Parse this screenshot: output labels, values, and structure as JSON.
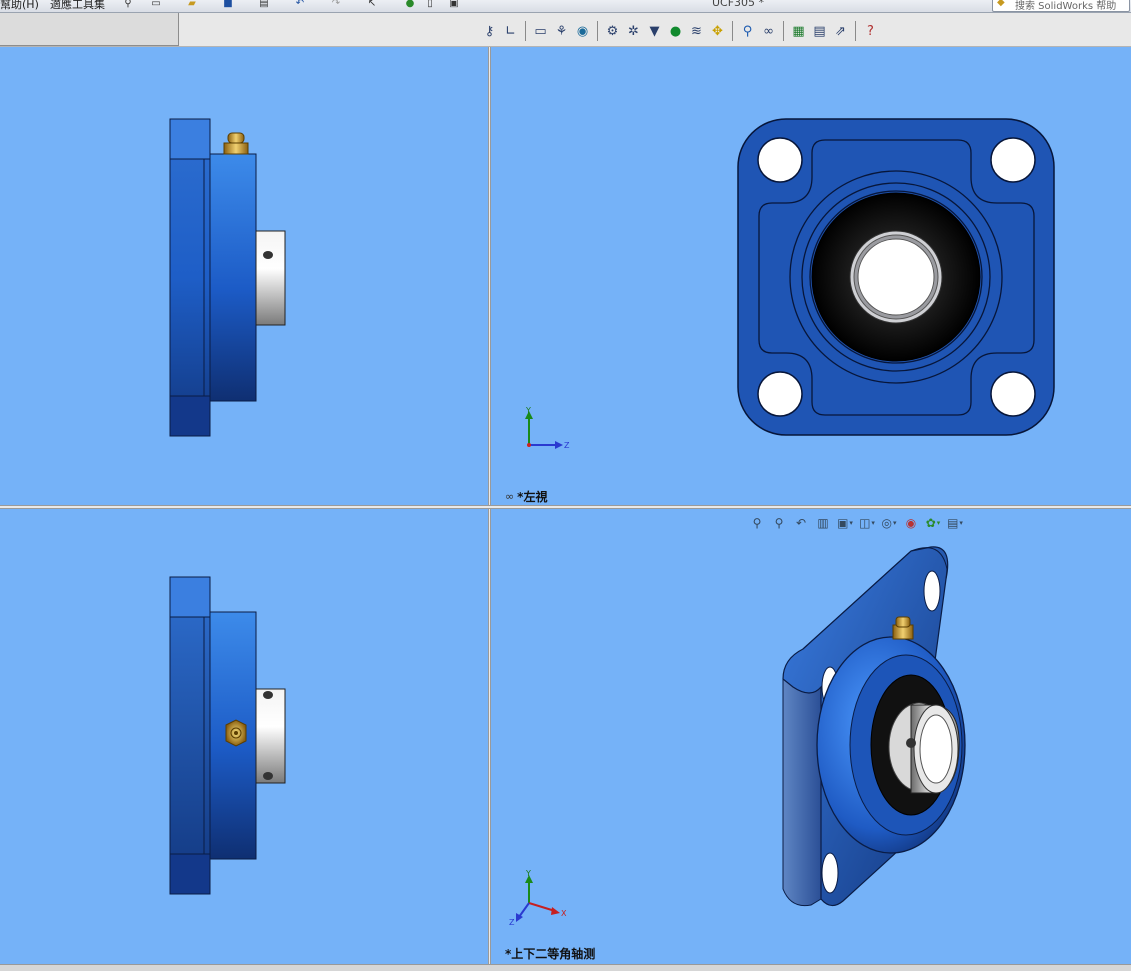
{
  "menubar": {
    "help_menu": "幫助(H)",
    "adapt_toolbar": "適應工具集",
    "doc_title": "UCF305 *",
    "search_placeholder": "搜索 SolidWorks 帮助"
  },
  "heads_up_toolbar": {
    "icons": [
      "key-icon",
      "angle-icon",
      "monitor-icon",
      "hierarchy-icon",
      "globe-icon",
      "gear-icon",
      "gear2-icon",
      "funnel-icon",
      "pin-icon",
      "spring-icon",
      "move-icon",
      "zoom-icon",
      "binoculars-icon",
      "excel-icon",
      "printer-icon",
      "export-icon",
      "help-icon"
    ]
  },
  "views": {
    "top_right_label": "*左視",
    "bottom_right_label": "*上下二等角轴测"
  },
  "triad": {
    "y": "Y",
    "z": "Z",
    "x": "X"
  },
  "colors": {
    "viewport_bg": "#75b2f8",
    "part_blue": "#1f55b4",
    "part_dark": "#0f2f72",
    "brass": "#c99a2e"
  }
}
